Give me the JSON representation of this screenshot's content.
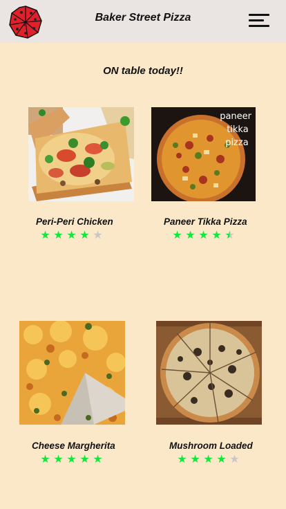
{
  "header": {
    "title": "Baker Street Pizza",
    "logo_icon": "pizza-logo-icon",
    "menu_icon": "hamburger-menu-icon"
  },
  "section_title": "ON table today!!",
  "colors": {
    "background": "#fbe8c9",
    "header": "#eae5e2",
    "star_on": "#12e83a",
    "star_off": "#c8c8c8",
    "logo_red": "#e0202a"
  },
  "pizzas": [
    {
      "name": "Peri-Peri Chicken",
      "rating": 4,
      "max": 5
    },
    {
      "name": "Paneer Tikka Pizza",
      "rating": 4.5,
      "max": 5,
      "image_caption": [
        "paneer",
        "tikka",
        "pizza"
      ]
    },
    {
      "name": "Cheese Margherita",
      "rating": 5,
      "max": 5
    },
    {
      "name": "Mushroom Loaded",
      "rating": 4,
      "max": 5
    }
  ]
}
